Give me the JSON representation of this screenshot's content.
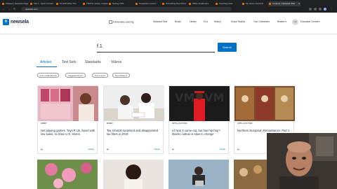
{
  "browser": {
    "tabs": [
      {
        "label": "Classes | Newsela Page"
      },
      {
        "label": "Tab 2 - Synk Content"
      },
      {
        "label": "CLASS Write The"
      },
      {
        "label": "TMATH Library Capital"
      },
      {
        "label": "Setting CSS"
      },
      {
        "label": "Newsela's Custom"
      },
      {
        "label": "Something Next Drive"
      },
      {
        "label": "Office Academics"
      },
      {
        "label": "Teaching-units"
      },
      {
        "label": "My Home Interests"
      },
      {
        "label": "Lessons | Newsela Shar"
      },
      {
        "label": "+"
      }
    ],
    "active_tab": "CLASS Write The",
    "url": "newsela.com"
  },
  "header": {
    "logo_text": "newsela",
    "nav": [
      "Elementary Learning",
      "Standard Sets",
      "Books",
      "Library",
      "ELA",
      "History",
      "Social Studies",
      "Your Collections",
      "Binders"
    ],
    "avatar": "LW",
    "user_label": "Education Central"
  },
  "search": {
    "value": "f.1",
    "button_label": "Search"
  },
  "content_tabs": [
    "Articles",
    "Text Sets",
    "Standards",
    "Videos"
  ],
  "filters": [
    "From Collections",
    "Suggested For",
    "Text Level",
    "More Filters"
  ],
  "cards": [
    {
      "tag": "HOBBY",
      "title": "Not playing games: Toys R Us, faced with low sales, to close U.S. stores",
      "meta": "Lexile",
      "assign": "Assign"
    },
    {
      "tag": "MONEY",
      "title": "Tax refunds surprised and disappointed tax filers in 2019",
      "meta": "Lexile",
      "assign": "Assign"
    },
    {
      "tag": "ARTS & CULTURE",
      "title": "Lil Nas X came out, but has hip-hop? Macho culture is slow to change",
      "meta": "Lexile",
      "assign": "Assign"
    },
    {
      "tag": "ARTS & CULTURE",
      "title": "Northern European Renaissance: Part 1",
      "meta": "Lexile",
      "assign": "Assign"
    }
  ]
}
